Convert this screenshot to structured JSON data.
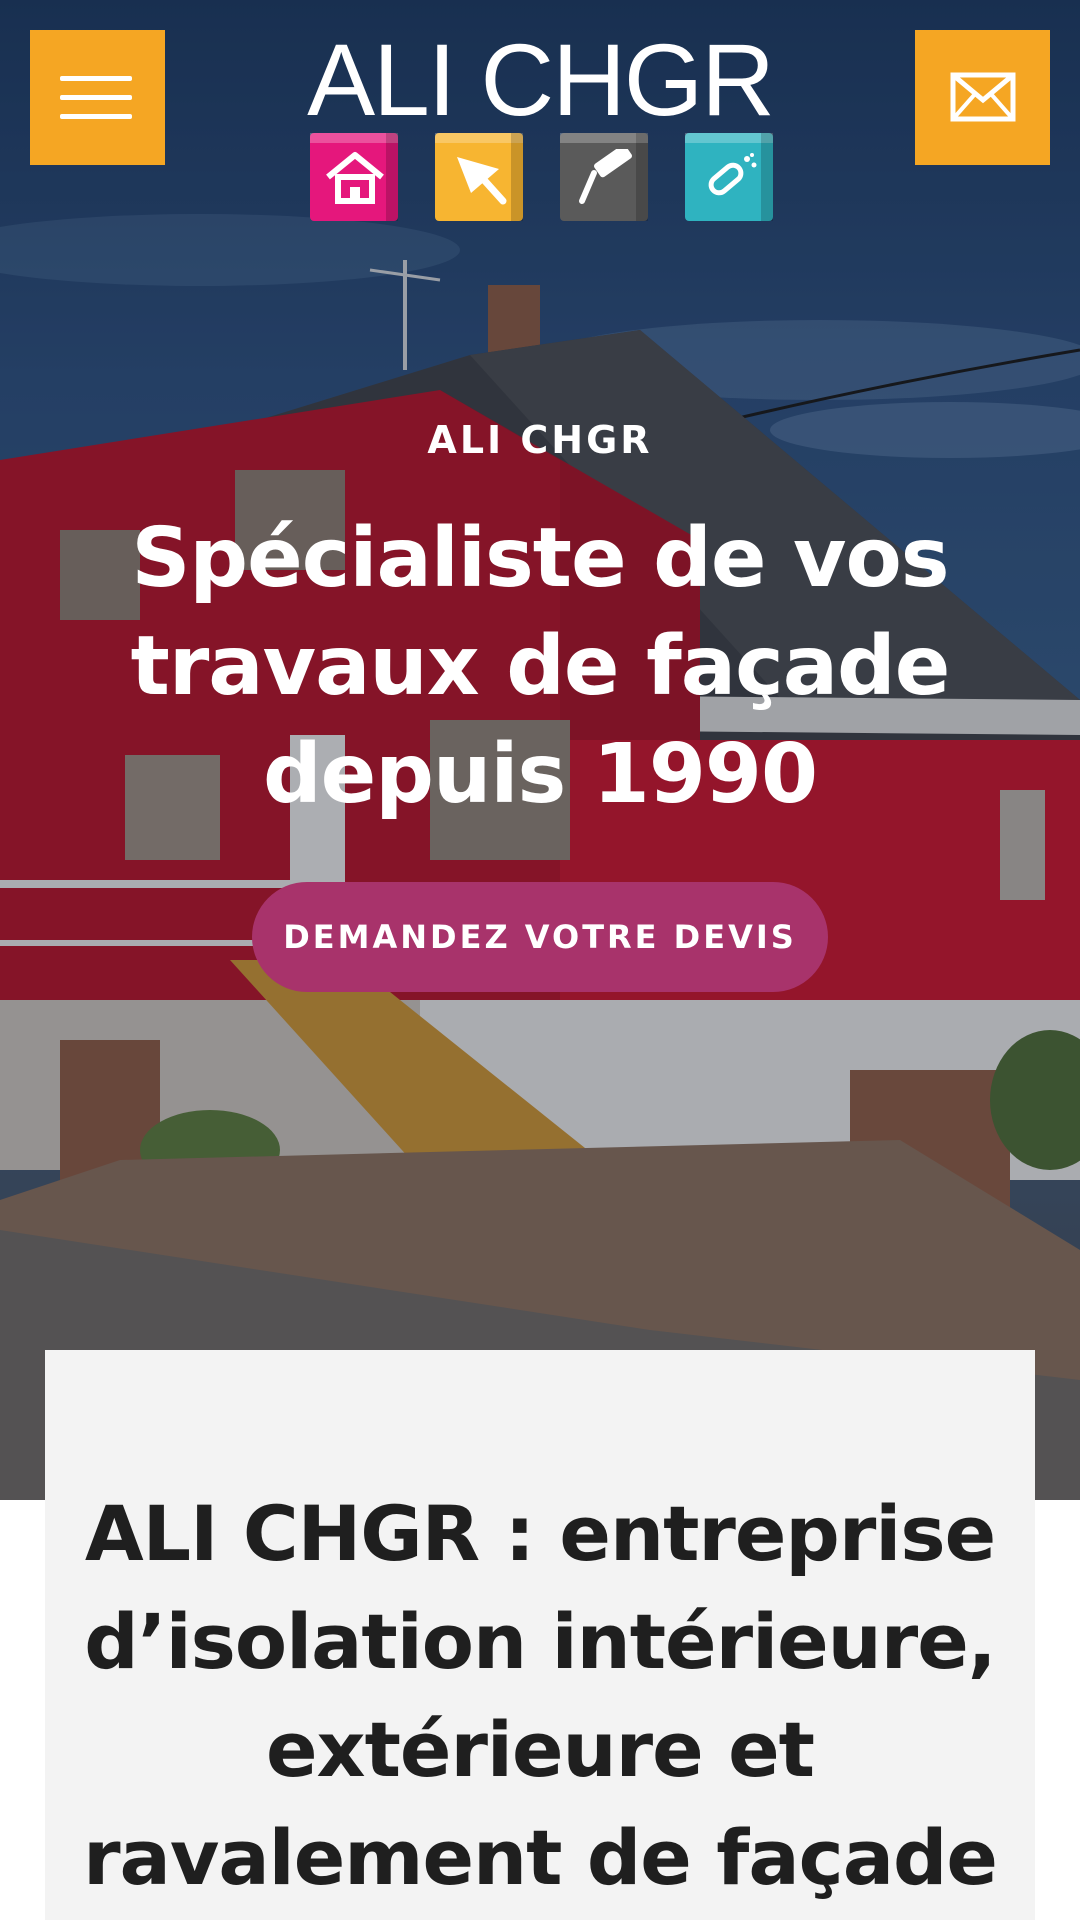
{
  "header": {
    "menu_icon": "hamburger-menu-icon",
    "mail_icon": "envelope-icon",
    "accent_color": "#f5a623",
    "logo": {
      "text": "ALI CHGR",
      "cube_colors": [
        "#e5177c",
        "#f7b531",
        "#5a5a5a",
        "#2fb3c0"
      ],
      "cube_icons": [
        "house-icon",
        "trowel-icon",
        "paint-roller-icon",
        "spray-gun-icon"
      ]
    }
  },
  "hero": {
    "kicker": "ALI CHGR",
    "title": "Spécialiste de vos travaux de façade depuis 1990",
    "cta_label": "DEMANDEZ VOTRE DEVIS",
    "cta_color": "#a8336b"
  },
  "intro": {
    "heading": "ALI CHGR : entreprise d’isolation intérieure, extérieure et ravalement de façade"
  }
}
